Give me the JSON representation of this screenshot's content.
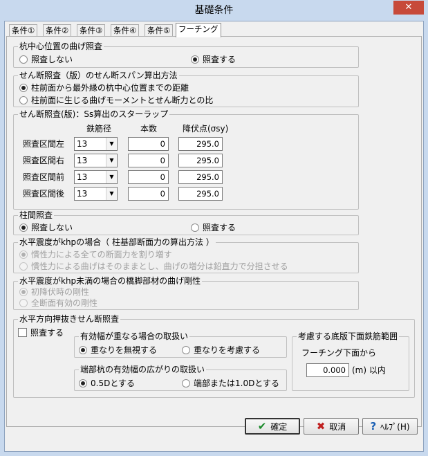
{
  "window": {
    "title": "基礎条件",
    "close_glyph": "✕"
  },
  "tabs": [
    "条件①",
    "条件②",
    "条件③",
    "条件④",
    "条件⑤",
    "フーチング"
  ],
  "pile_center_bending": {
    "title": "杭中心位置の曲げ照査",
    "option_no": "照査しない",
    "option_yes": "照査する"
  },
  "shear_span": {
    "title": "せん断照査（版）のせん断スパン算出方法",
    "option_1": "柱前面から最外縁の杭中心位置までの距離",
    "option_2": "柱前面に生じる曲げモーメントとせん断力との比"
  },
  "stirrup": {
    "title": "せん断照査(版)：Ss算出のスターラップ",
    "col_diameter": "鉄筋径",
    "col_count": "本数",
    "col_yield": "降伏点(σsy)",
    "rows": [
      {
        "label": "照査区間左",
        "diameter": "13",
        "count": "0",
        "yield": "295.0"
      },
      {
        "label": "照査区間右",
        "diameter": "13",
        "count": "0",
        "yield": "295.0"
      },
      {
        "label": "照査区間前",
        "diameter": "13",
        "count": "0",
        "yield": "295.0"
      },
      {
        "label": "照査区間後",
        "diameter": "13",
        "count": "0",
        "yield": "295.0"
      }
    ]
  },
  "inter_column": {
    "title": "柱間照査",
    "option_no": "照査しない",
    "option_yes": "照査する"
  },
  "khp_case": {
    "title": "水平震度がkhpの場合（ 柱基部断面力の算出方法 ）",
    "option_1": "慣性力による全ての断面力を割り増す",
    "option_2": "慣性力による曲げはそのままとし、曲げの増分は鉛直力で分担させる"
  },
  "khp_under": {
    "title": "水平震度がkhp未満の場合の橋脚部材の曲げ剛性",
    "option_1": "初降伏時の剛性",
    "option_2": "全断面有効の剛性"
  },
  "punching": {
    "title": "水平方向押抜きせん断照査",
    "check_label": "照査する",
    "overlap": {
      "title": "有効幅が重なる場合の取扱い",
      "option_ignore": "重なりを無視する",
      "option_consider": "重なりを考慮する"
    },
    "end_pile": {
      "title": "端部杭の有効幅の広がりの取扱い",
      "option_05d": "0.5Dとする",
      "option_10d": "端部または1.0Dとする"
    },
    "rebar_range": {
      "title": "考慮する底版下面鉄筋範囲",
      "from_label": "フーチング下面から",
      "value": "0.000",
      "unit": "(m) 以内"
    }
  },
  "buttons": {
    "ok": "確定",
    "cancel": "取消",
    "help": "ﾍﾙﾌﾟ(H)"
  },
  "colors": {
    "ok_icon": "#1a8a2a",
    "cancel_icon": "#c02020",
    "help_icon": "#1a5fb4"
  }
}
